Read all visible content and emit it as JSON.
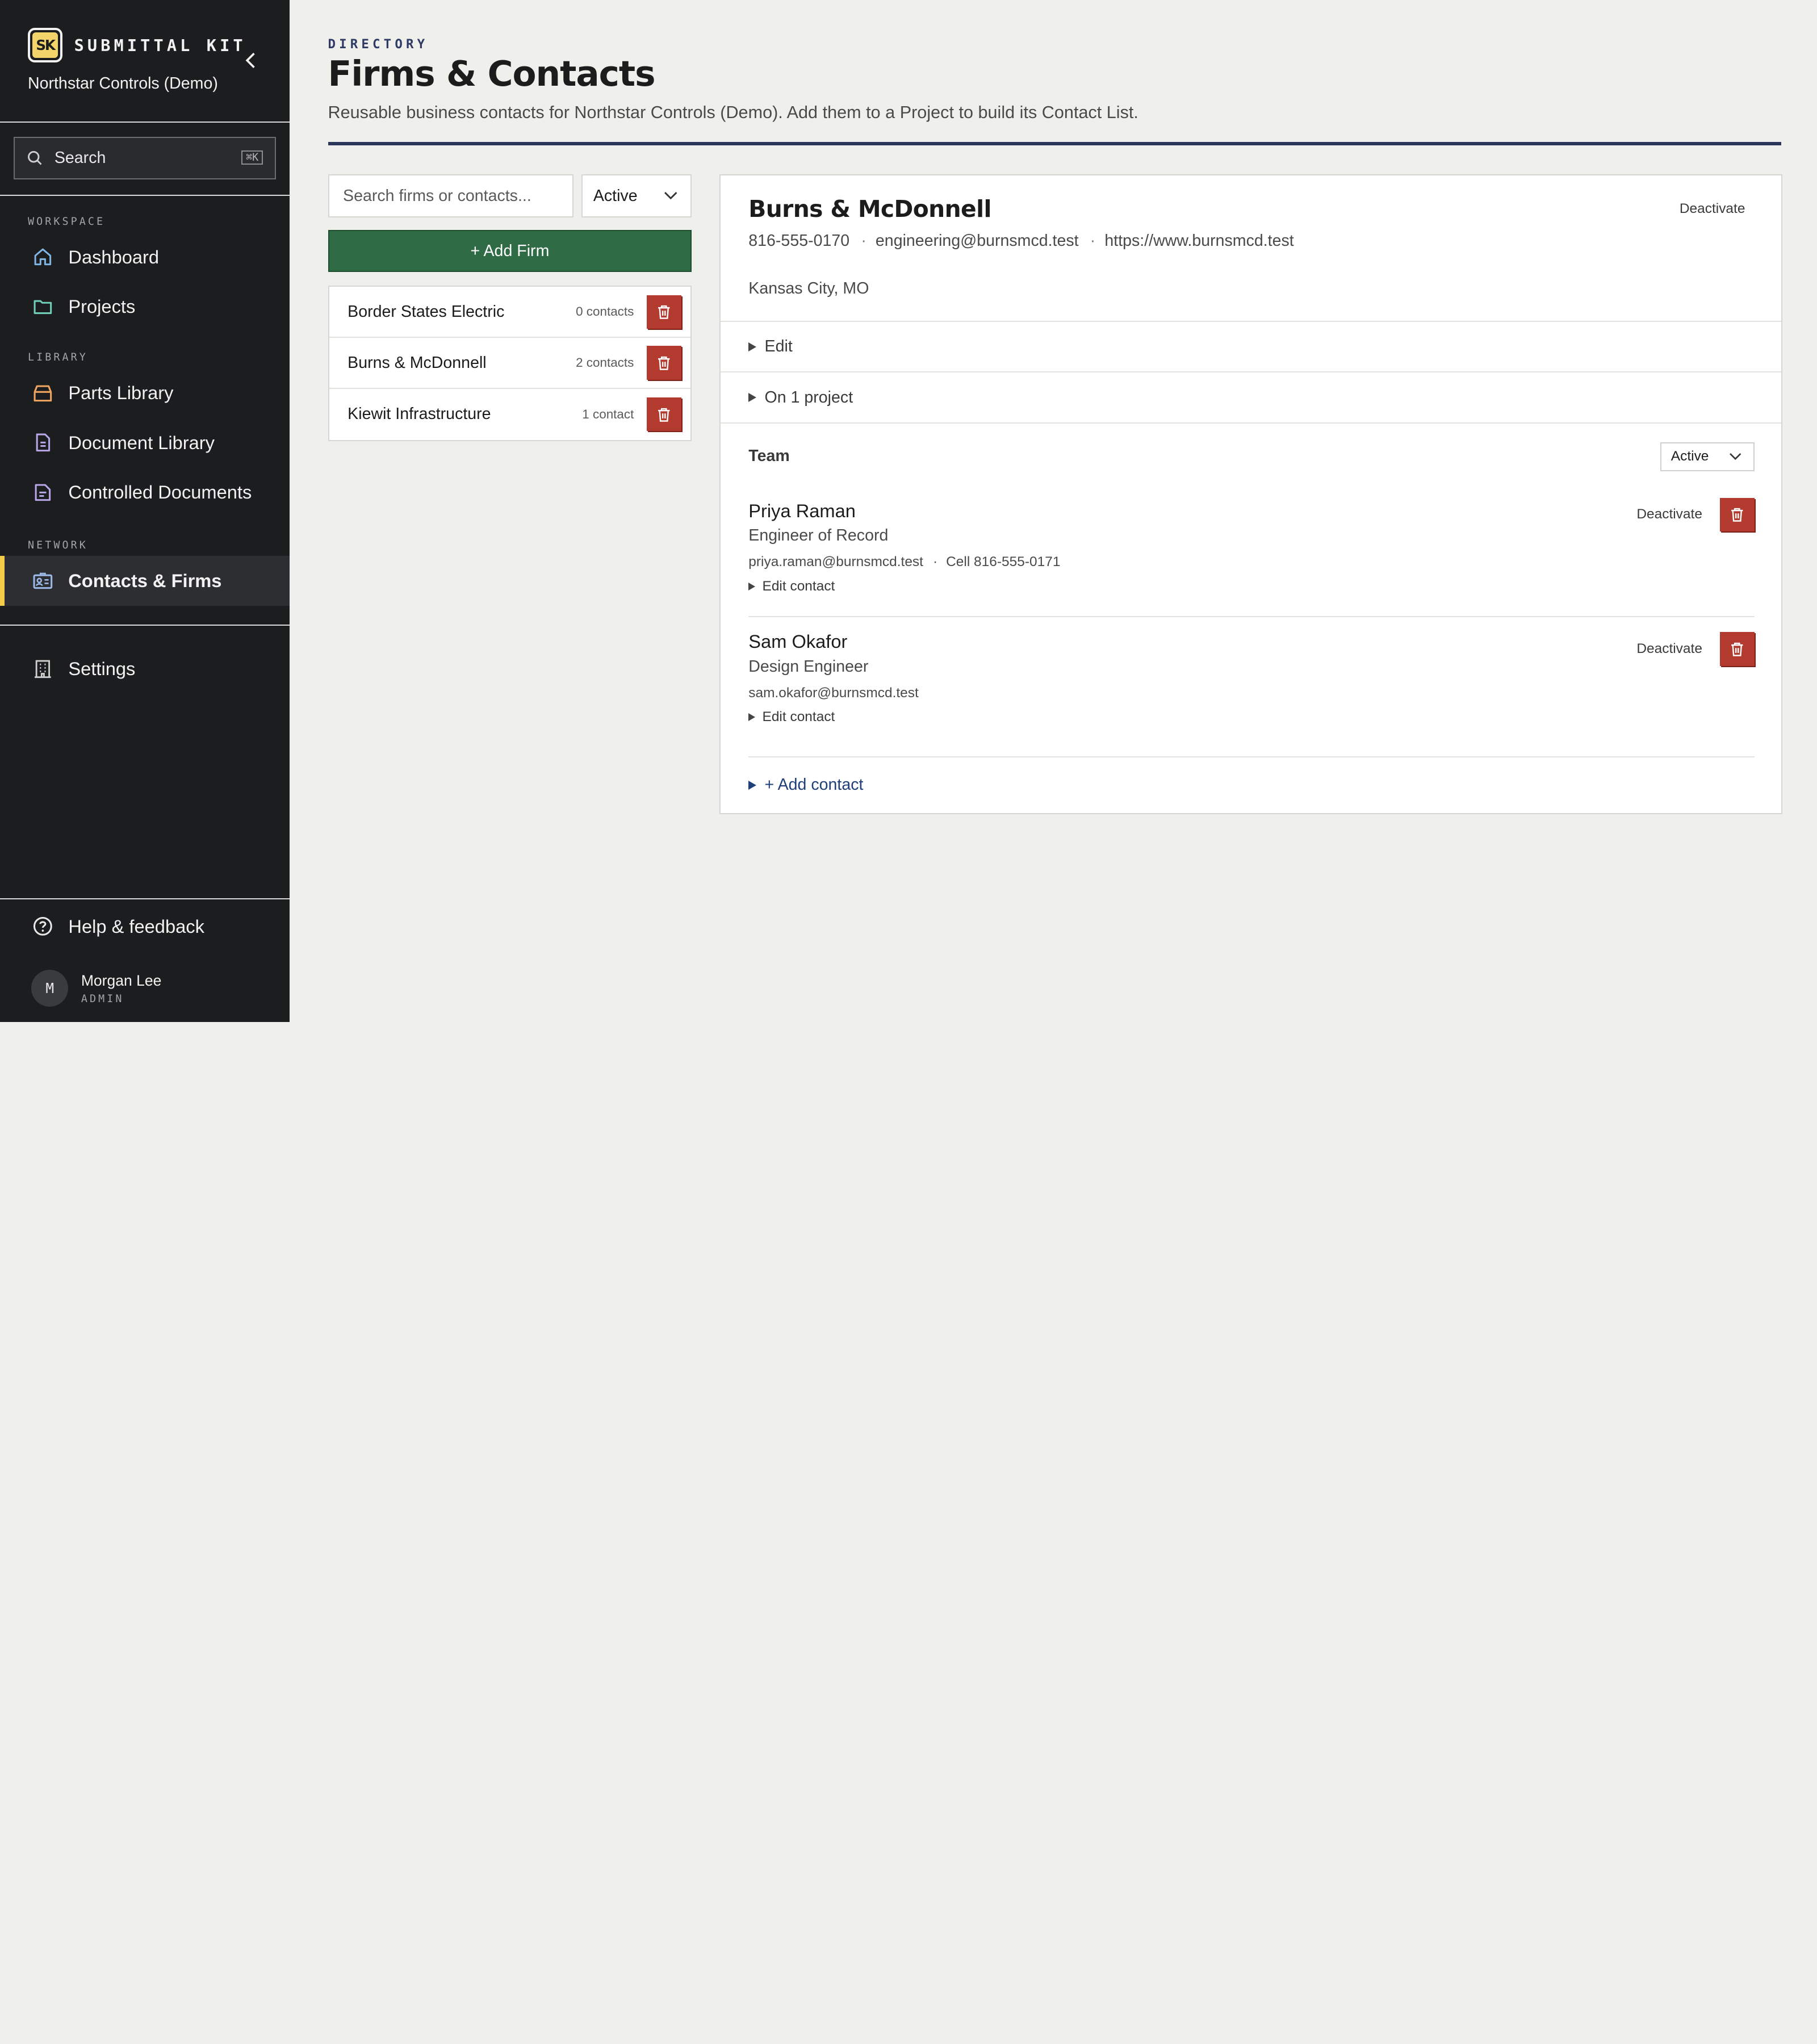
{
  "app": {
    "brand_mark": "SK",
    "brand_name": "SUBMITTAL KIT",
    "org_name": "Northstar Controls (Demo)"
  },
  "sidebar": {
    "search_label": "Search",
    "search_shortcut": "⌘K",
    "sections": {
      "workspace": "WORKSPACE",
      "library": "LIBRARY",
      "network": "NETWORK"
    },
    "items": {
      "dashboard": "Dashboard",
      "projects": "Projects",
      "parts_library": "Parts Library",
      "document_library": "Document Library",
      "controlled_documents": "Controlled Documents",
      "contacts_firms": "Contacts & Firms",
      "settings": "Settings",
      "help": "Help & feedback"
    },
    "user": {
      "initial": "M",
      "name": "Morgan Lee",
      "role": "ADMIN"
    }
  },
  "header": {
    "eyebrow": "DIRECTORY",
    "title": "Firms & Contacts",
    "subtitle": "Reusable business contacts for Northstar Controls (Demo). Add them to a Project to build its Contact List."
  },
  "firm_panel": {
    "search_placeholder": "Search firms or contacts...",
    "status_filter": "Active",
    "add_firm_label": "+ Add Firm",
    "firms": [
      {
        "name": "Border States Electric",
        "count": "0 contacts"
      },
      {
        "name": "Burns & McDonnell",
        "count": "2 contacts"
      },
      {
        "name": "Kiewit Infrastructure",
        "count": "1 contact"
      }
    ]
  },
  "detail": {
    "name": "Burns & McDonnell",
    "phone": "816-555-0170",
    "email": "engineering@burnsmcd.test",
    "website": "https://www.burnsmcd.test",
    "location": "Kansas City, MO",
    "deactivate_label": "Deactivate",
    "edit_label": "Edit",
    "projects_label": "On 1 project",
    "team_label": "Team",
    "team_filter": "Active",
    "contacts": [
      {
        "name": "Priya Raman",
        "role": "Engineer of Record",
        "email": "priya.raman@burnsmcd.test",
        "phone": "Cell 816-555-0171",
        "deactivate_label": "Deactivate",
        "edit_label": "Edit contact"
      },
      {
        "name": "Sam Okafor",
        "role": "Design Engineer",
        "email": "sam.okafor@burnsmcd.test",
        "deactivate_label": "Deactivate",
        "edit_label": "Edit contact"
      }
    ],
    "add_contact_label": "+ Add contact"
  },
  "colors": {
    "sidebar_bg": "#1c1d1f",
    "active_accent": "#f3cc4a",
    "primary_button": "#2f6b45",
    "danger": "#b23a2f",
    "heading_rule": "#2b3559",
    "link": "#1f3f7a"
  }
}
